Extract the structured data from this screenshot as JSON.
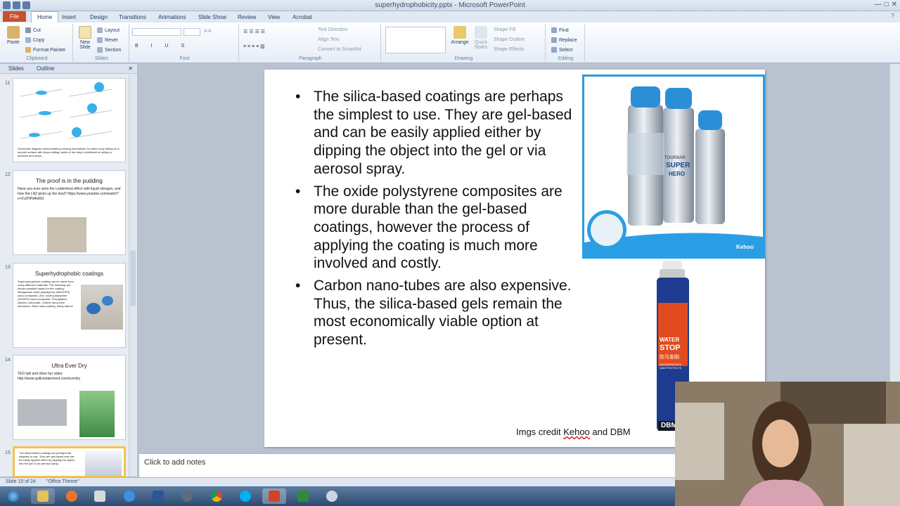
{
  "window": {
    "title": "superhydrophobicity.pptx - Microsoft PowerPoint"
  },
  "tabs": [
    "File",
    "Home",
    "Insert",
    "Design",
    "Transitions",
    "Animations",
    "Slide Show",
    "Review",
    "View",
    "Acrobat"
  ],
  "ribbon": {
    "clipboard": {
      "paste": "Paste",
      "cut": "Cut",
      "copy": "Copy",
      "format_painter": "Format Painter",
      "label": "Clipboard"
    },
    "slides": {
      "new_slide": "New Slide",
      "layout": "Layout",
      "reset": "Reset",
      "section": "Section",
      "label": "Slides"
    },
    "font": {
      "label": "Font"
    },
    "paragraph": {
      "text_direction": "Text Direction",
      "align_text": "Align Text",
      "convert": "Convert to SmartArt",
      "label": "Paragraph"
    },
    "drawing": {
      "arrange": "Arrange",
      "quick_styles": "Quick Styles",
      "shape_fill": "Shape Fill",
      "shape_outline": "Shape Outline",
      "shape_effects": "Shape Effects",
      "label": "Drawing"
    },
    "editing": {
      "find": "Find",
      "replace": "Replace",
      "select": "Select",
      "label": "Editing"
    }
  },
  "left_pane": {
    "tabs": [
      "Slides",
      "Outline"
    ],
    "slides": [
      {
        "num": "11",
        "title": "",
        "body": "Schematic diagram demonstrating Leaving mechanism for water drop sliding on a smooth surface with drops sliding, water of the drop's intefficient at rolling or particles and drops ..."
      },
      {
        "num": "12",
        "title": "The proof is in the pudding",
        "body": "Have you ever seen the Leidenfrost effect with liquid nitrogen, and how the LN2 picks up the dust? https://www.youtube.com/watch?v=ZvZHPd4s8GI"
      },
      {
        "num": "13",
        "title": "Superhydrophobic coatings",
        "body": "Superhydrophobic coating can be made from many different materials. The following are known possible bases for the coating: Manganese oxide polystyrene (MnO2/PS) nano-composite, Zinc oxide polystyrene (ZnO/PS) nano-composite, Precipitated calcium carbonate, Carbon nano-tube structures, Silica nano-coating, Many others!"
      },
      {
        "num": "14",
        "title": "Ultra Ever Dry",
        "body": "TED talk and other fun video: http://www.spillcontainment.com/everdry"
      },
      {
        "num": "15",
        "title": "",
        "body": "The silica-based coatings are perhaps the simplest to use. They are gel-based and can be easily applied either by dipping the object into the gel or via aerosol spray."
      }
    ]
  },
  "main_slide": {
    "bullets": [
      "The silica-based coatings are perhaps the simplest to use. They are gel-based and can be easily applied either by dipping the object into the gel or via aerosol spray.",
      "The oxide polystyrene composites are more durable than the gel-based coatings, however the process of applying the coating is much more involved and costly.",
      "Carbon nano-tubes are also expensive. Thus, the silica-based gels remain the most economically viable option at present."
    ],
    "image1": {
      "brand_small": "TOORBAR",
      "brand": "SUPER",
      "sub": "HERO",
      "logo": "Kehoo"
    },
    "image2": {
      "text_top": "WATER",
      "text_mid": "STOP",
      "text_cn": "防污金刚",
      "sub": "WATERPROOFS AND PROTECTS",
      "brand": "DBM"
    },
    "credit_prefix": "Imgs credit ",
    "credit_name": "Kehoo",
    "credit_suffix": " and DBM"
  },
  "notes": {
    "placeholder": "Click to add notes"
  },
  "status": {
    "slide": "Slide 15 of 24",
    "theme": "\"Office Theme\""
  },
  "colors": {
    "accent": "#2a9ee4",
    "file_tab": "#c8502e",
    "selected_slide": "#f4c34f"
  }
}
